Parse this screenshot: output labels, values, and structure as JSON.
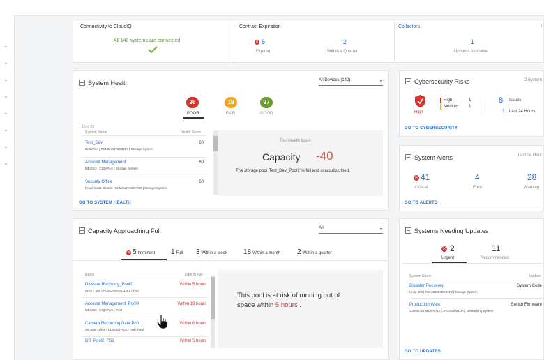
{
  "connectivity": {
    "title": "Connectivity to CloudIQ",
    "status": "All 148 systems are connected"
  },
  "contract": {
    "title": "Contract Expiration",
    "expired_count": "6",
    "expired_label": "Expired",
    "quarter_count": "2",
    "quarter_label": "Within a Quarter"
  },
  "collectors": {
    "title": "Collectors",
    "count": "1",
    "label": "Updates Available",
    "more": "\\"
  },
  "health": {
    "title": "System Health",
    "filter": "All Devices (142)",
    "poor": "26",
    "poor_label": "POOR",
    "fair": "19",
    "fair_label": "FAIR",
    "good": "97",
    "good_label": "GOOD",
    "count_text": "10 of 26",
    "col_name": "System Name",
    "col_score": "Health Score",
    "rows": [
      {
        "name": "Test_Dev",
        "score": "60",
        "sub": "UnityVSA | FCNCH0972C32F3 | Storage System"
      },
      {
        "name": "Account Management",
        "score": "60",
        "sub": "ME4012 | CIQAPU1 | Storage System"
      },
      {
        "name": "Security Office",
        "score": "60",
        "sub": "PowerScale Cluster | ELMISLFAGEF789 | Storage System"
      }
    ],
    "top_issue_label": "Top Health Issue",
    "issue_name": "Capacity",
    "issue_value": "-40",
    "issue_desc": "The storage pool 'Test_Dev_Pool1' is full and oversubscribed.",
    "link": "GO TO SYSTEM HEALTH"
  },
  "cyber": {
    "title": "Cybersecurity Risks",
    "systems": "2 System",
    "risk": "High",
    "high_label": "High",
    "high_count": "1",
    "medium_label": "Medium",
    "medium_count": "1",
    "issues_count": "8",
    "issues_label": "Issues",
    "recent_count": "1",
    "recent_label": "Last 24 Hours",
    "link": "GO TO CYBERSECURITY"
  },
  "alerts": {
    "title": "System Alerts",
    "period": "Last 24 Hour",
    "critical": "41",
    "critical_label": "Critical",
    "error": "4",
    "error_label": "Error",
    "warning": "28",
    "warning_label": "Warning",
    "link": "GO TO ALERTS"
  },
  "capacity": {
    "title": "Capacity Approaching Full",
    "filter": "All",
    "tabs": [
      {
        "count": "5",
        "label": "Imminent"
      },
      {
        "count": "1",
        "label": "Full"
      },
      {
        "count": "3",
        "label": "Within a week"
      },
      {
        "count": "18",
        "label": "Within a month"
      },
      {
        "count": "2",
        "label": "Within a quarter"
      }
    ],
    "col_name": "Name",
    "col_date": "Date to Full",
    "rows": [
      {
        "name": "Disaster Recovery_Pool2",
        "date": "Within 5 hours",
        "sub": "UNITY 400 | FCNCH0972C32F2 | Pool"
      },
      {
        "name": "Account Management_PoolA",
        "date": "Within 19 hours",
        "sub": "ME4012 | CIQAPU1 | Pool"
      },
      {
        "name": "Camera Recording Data Pool",
        "date": "Within 6 hours",
        "sub": "Security Office | ELMISLFAGEF789 | Pool"
      },
      {
        "name": "DR_Pool2_FS1",
        "date": "Within 5 hours",
        "sub": ""
      }
    ],
    "msg_prefix": "This pool is at risk of running out of",
    "msg_line2": "space within",
    "msg_value": "5 hours",
    "msg_suffix": "."
  },
  "updates": {
    "title": "Systems Needing Updates",
    "urgent": "2",
    "urgent_label": "Urgent",
    "recommended": "11",
    "recommended_label": "Recommended",
    "col_name": "System Name",
    "col_update": "Update",
    "rows": [
      {
        "name": "Disaster Recovery",
        "update": "System Code",
        "sub": "Unity 400 | FCNCH0972C32F2 | Storage System"
      },
      {
        "name": "Production West",
        "update": "Switch Firmware",
        "sub": "Connectrix MDS-9710 | JPG194001DK | Networking System"
      }
    ],
    "link": "GO TO UPDATES"
  }
}
